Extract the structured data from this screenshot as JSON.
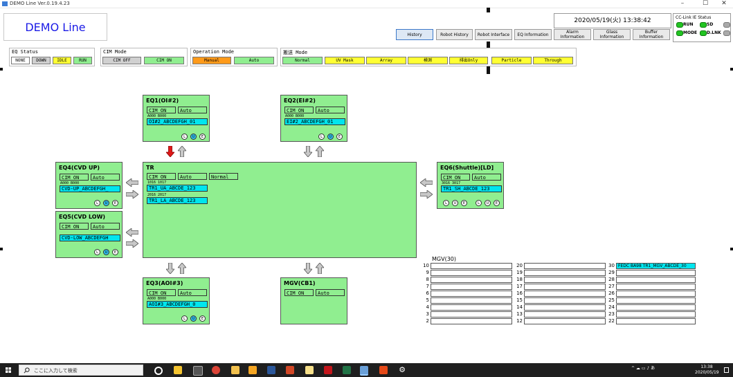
{
  "window": {
    "title": "DEMO Line Ver.0.19.4.23",
    "minimize": "–",
    "maximize": "☐",
    "close": "✕"
  },
  "header": {
    "logo": "DEMO Line",
    "clock": "2020/05/19(火) 13:38:42",
    "nav": [
      {
        "label": "History",
        "active": true
      },
      {
        "label": "Robot History"
      },
      {
        "label": "Robot Interface"
      },
      {
        "label": "EQ Information"
      },
      {
        "label": "Alarm Information"
      },
      {
        "label": "Glass Information"
      },
      {
        "label": "Buffer Information"
      }
    ],
    "cclink": {
      "title": "CC-Link IE Status",
      "leds": [
        "RUN",
        "SD",
        "",
        "MODE",
        "D.LNK",
        ""
      ]
    }
  },
  "status": {
    "eq": {
      "title": "EQ Status",
      "items": [
        "NONE",
        "DOWN",
        "IDLE",
        "RUN"
      ]
    },
    "cim": {
      "title": "CIM Mode",
      "items": [
        "CIM OFF",
        "CIM ON"
      ]
    },
    "op": {
      "title": "Operation Mode",
      "items": [
        "Manual",
        "Auto"
      ]
    },
    "transfer": {
      "title": "搬送 Mode",
      "items": [
        "Normal",
        "UV Mask",
        "Array",
        "検測",
        "排出Only",
        "Particle",
        "Through"
      ]
    }
  },
  "colors": {
    "green": "#90ee90",
    "cyan": "#00e5ee",
    "yellow": "#ffff33",
    "orange": "#ff9a1a",
    "grey": "#d0d0d0",
    "red": "#e01818"
  },
  "eq1": {
    "name": "EQ1(OI#2)",
    "cim": "CIM ON",
    "mode": "Auto",
    "ports": "A000 B000",
    "glass": "OI#2_ABCDEFGH_01",
    "c1": "L",
    "c2": "U",
    "c3": "E"
  },
  "eq2": {
    "name": "EQ2(EI#2)",
    "cim": "CIM ON",
    "mode": "Auto",
    "ports": "A000 B000",
    "glass": "EI#2_ABCDEFGH_01",
    "c1": "L",
    "c2": "U",
    "c3": "E"
  },
  "eq3": {
    "name": "EQ3(AOI#3)",
    "cim": "CIM ON",
    "mode": "Auto",
    "ports": "A000 B000",
    "glass": "AOI#3_ABCDEFGH_0",
    "c1": "L",
    "c2": "U",
    "c3": "E"
  },
  "eq4": {
    "name": "EQ4(CVD UP)",
    "cim": "CIM ON",
    "mode": "Auto",
    "ports": "A000 B000",
    "glass": "CVD-UP_ABCDEFGH_",
    "c1": "L",
    "c2": "U",
    "c3": "E"
  },
  "eq5": {
    "name": "EQ5(CVD LOW)",
    "cim": "CIM ON",
    "mode": "Auto",
    "glass": "CVD-LOW_ABCDEFGH",
    "c1": "L",
    "c2": "U",
    "c3": "E"
  },
  "eq6": {
    "name": "EQ6(Shuttle)[LD]",
    "cim": "CIM ON",
    "mode": "Auto",
    "ports": "3016 3017",
    "glass": "TR1_SH_ABCDE_123",
    "c1": "L",
    "c2": "U",
    "c3": "E",
    "c4": "L",
    "c5": "U",
    "c6": "E"
  },
  "tr": {
    "name": "TR",
    "cim": "CIM ON",
    "mode": "Auto",
    "state": "Normal",
    "ports1": "1016 1017",
    "glass1": "TR1_UA_ABCDE_123",
    "ports2": "2016 2017",
    "glass2": "TR1_LA_ABCDE_123"
  },
  "mgvcb": {
    "name": "MGV(CB1)",
    "cim": "CIM ON",
    "mode": "Auto"
  },
  "mgv": {
    "title": "MGV(30)",
    "col1": [
      "10",
      "9",
      "8",
      "7",
      "6",
      "5",
      "4",
      "3",
      "2"
    ],
    "col2": [
      "20",
      "19",
      "18",
      "17",
      "16",
      "15",
      "14",
      "13",
      "12"
    ],
    "col3": [
      "30",
      "29",
      "28",
      "27",
      "26",
      "25",
      "24",
      "23",
      "22"
    ],
    "slot30": "FEDC BA98 TR1_MGV_ABCDE_30"
  },
  "taskbar": {
    "search": "ここに入力して検索",
    "time": "13:38",
    "date": "2020/05/19"
  }
}
